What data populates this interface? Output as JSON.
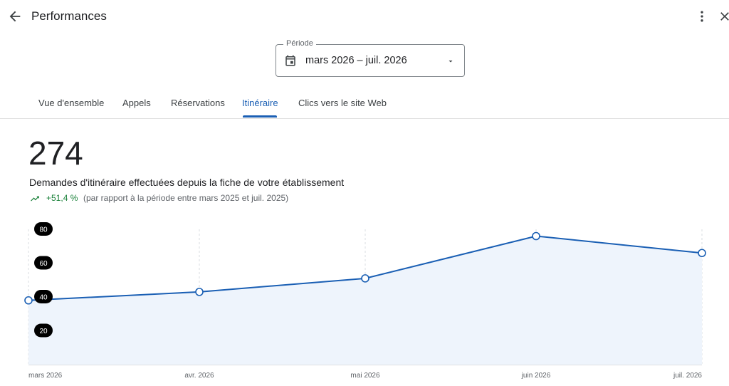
{
  "header": {
    "title": "Performances",
    "back_icon": "arrow-back-icon",
    "more_icon": "more-vert-icon",
    "close_icon": "close-icon"
  },
  "period": {
    "label": "Période",
    "value": "mars 2026 – juil. 2026",
    "icon": "calendar-icon",
    "caret_icon": "dropdown-caret-icon"
  },
  "tabs": [
    {
      "label": "Vue d'ensemble",
      "active": false
    },
    {
      "label": "Appels",
      "active": false
    },
    {
      "label": "Réservations",
      "active": false
    },
    {
      "label": "Itinéraire",
      "active": true
    },
    {
      "label": "Clics vers le site Web",
      "active": false
    }
  ],
  "metric": {
    "value": "274",
    "description": "Demandes d'itinéraire effectuées depuis la fiche de votre établissement",
    "change": "+51,4 %",
    "comparison": "(par rapport à la période entre mars 2025 et juil. 2025)",
    "trend_icon": "trending-up-icon"
  },
  "colors": {
    "accent": "#1a5fb4",
    "positive": "#188038",
    "area_fill": "#eef4fc"
  },
  "chart_data": {
    "type": "area",
    "categories": [
      "mars 2026",
      "avr. 2026",
      "mai 2026",
      "juin 2026",
      "juil. 2026"
    ],
    "series": [
      {
        "values": [
          38,
          43,
          51,
          76,
          66
        ]
      }
    ],
    "y_ticks": [
      "80",
      "60",
      "40",
      "20"
    ],
    "ylim": [
      0,
      80
    ],
    "grid": "vertical-dashed",
    "legend": "none"
  }
}
